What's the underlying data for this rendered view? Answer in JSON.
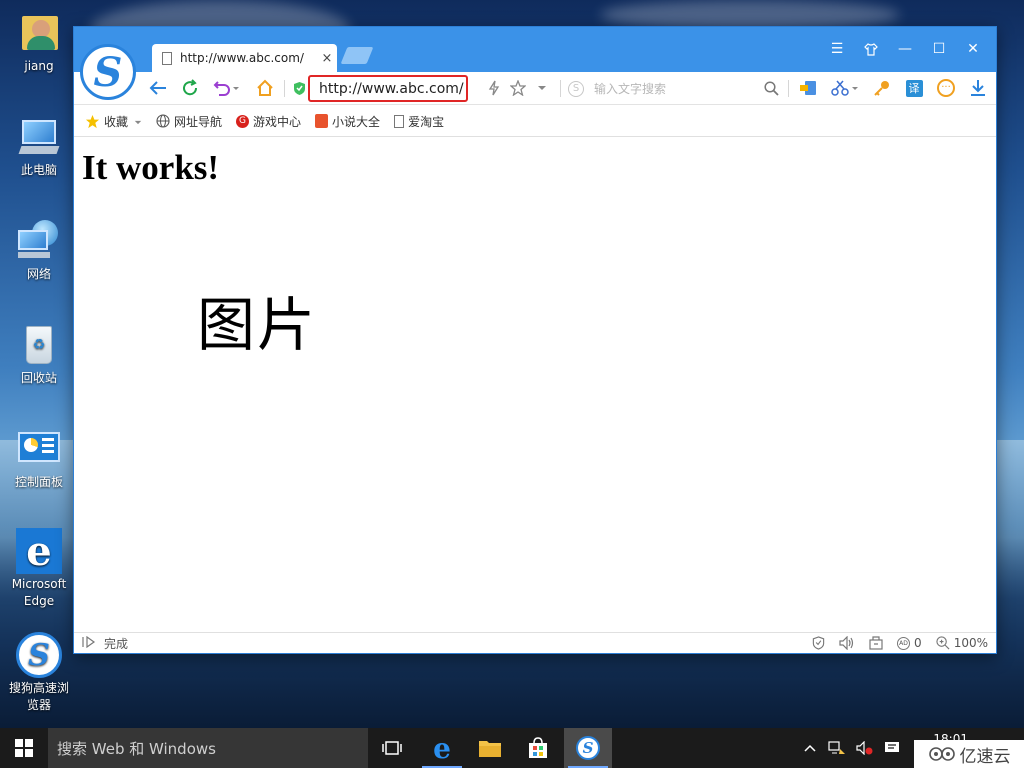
{
  "desktop": {
    "icons": [
      {
        "label": "jiang",
        "icon": "user-folder-icon"
      },
      {
        "label": "此电脑",
        "icon": "computer-icon"
      },
      {
        "label": "网络",
        "icon": "network-icon"
      },
      {
        "label": "回收站",
        "icon": "recycle-bin-icon"
      },
      {
        "label": "控制面板",
        "icon": "control-panel-icon"
      },
      {
        "label": "Microsoft Edge",
        "icon": "edge-icon"
      },
      {
        "label": "搜狗高速浏览器",
        "icon": "sogou-browser-icon"
      }
    ]
  },
  "browser": {
    "tab": {
      "title": "http://www.abc.com/",
      "close": "×"
    },
    "window_buttons": {
      "menu": "☰",
      "skin": "👕",
      "minimize": "—",
      "maximize": "☐",
      "close": "✕"
    },
    "address": "http://www.abc.com/",
    "search_placeholder": "输入文字搜索",
    "bookmarks": [
      {
        "label": "收藏",
        "icon": "star-icon"
      },
      {
        "label": "网址导航",
        "icon": "globe-icon"
      },
      {
        "label": "游戏中心",
        "icon": "game-icon"
      },
      {
        "label": "小说大全",
        "icon": "novel-icon"
      },
      {
        "label": "爱淘宝",
        "icon": "page-icon"
      }
    ],
    "page": {
      "heading": "It works!",
      "image_alt": "图片"
    },
    "status": {
      "text": "完成",
      "ad_count": "0",
      "zoom": "100%"
    }
  },
  "taskbar": {
    "search_text": "搜索 Web 和 Windows",
    "clock": "18:01",
    "watermark": "亿速云"
  },
  "colors": {
    "accent": "#3b92e8",
    "address_border": "#e02626",
    "taskbar": "#1b1b1b"
  }
}
